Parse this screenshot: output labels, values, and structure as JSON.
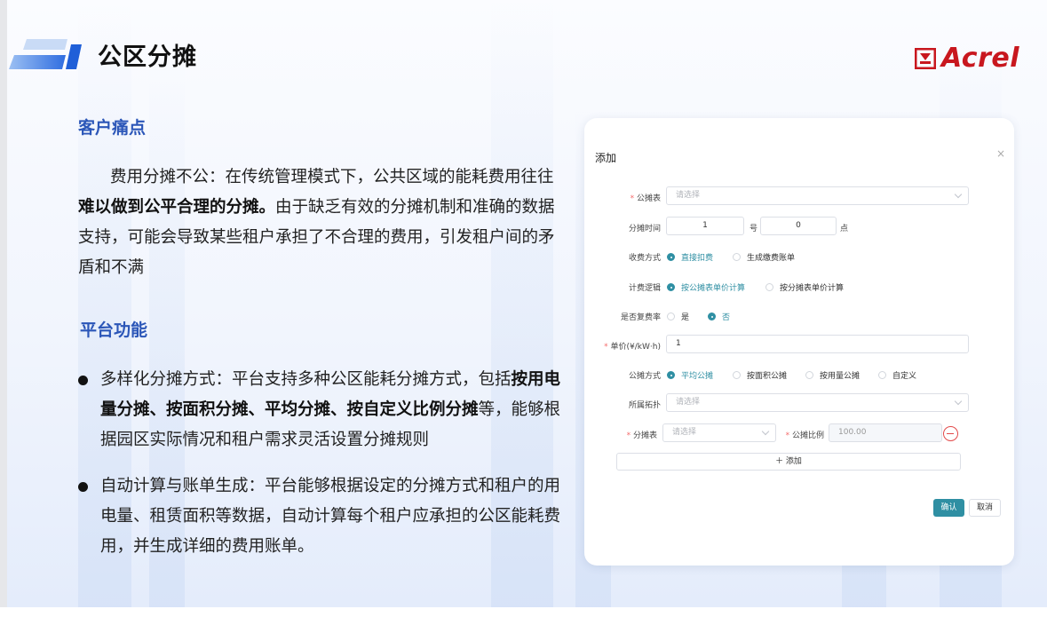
{
  "header": {
    "title": "公区分摊",
    "logo_text": "Acrel",
    "logo_color": "#c8171e"
  },
  "pain_points": {
    "heading": "客户痛点",
    "text_1": "费用分摊不公：在传统管理模式下，公共区域的能耗费用往往",
    "bold_1": "难以做到公平合理的分摊。",
    "text_2": "由于缺乏有效的分摊机制和准确的数据支持，可能会导致某些租户承担了不合理的费用，引发租户间的矛盾和不满"
  },
  "features": {
    "heading": "平台功能",
    "items": [
      {
        "text_1": "多样化分摊方式：平台支持多种公区能耗分摊方式，包括",
        "bold": "按用电量分摊、按面积分摊、平均分摊、按自定义比例分摊",
        "text_2": "等，能够根据园区实际情况和租户需求灵活设置分摊规则"
      },
      {
        "text_1": "自动计算与账单生成：平台能够根据设定的分摊方式和租户的用电量、租赁面积等数据，自动计算每个租户应承担的公区能耗费用，并生成详细的费用账单。",
        "bold": "",
        "text_2": ""
      }
    ]
  },
  "dialog": {
    "title": "添加",
    "close": "×",
    "meter_label": "公摊表",
    "meter_placeholder": "请选择",
    "time_label": "分摊时间",
    "day_value": "1",
    "day_unit": "号",
    "hour_value": "0",
    "hour_unit": "点",
    "charge_label": "收费方式",
    "charge_options": [
      "直接扣费",
      "生成缴费账单"
    ],
    "charge_selected": 0,
    "logic_label": "计费逻辑",
    "logic_options": [
      "按公摊表单价计算",
      "按分摊表单价计算"
    ],
    "logic_selected": 0,
    "multi_rate_label": "是否复费率",
    "multi_rate_options": [
      "是",
      "否"
    ],
    "multi_rate_selected": 1,
    "price_label": "单价(¥/kW·h)",
    "price_value": "1",
    "method_label": "公摊方式",
    "method_options": [
      "平均公摊",
      "按面积公摊",
      "按用量公摊",
      "自定义"
    ],
    "method_selected": 0,
    "topo_label": "所属拓扑",
    "topo_placeholder": "请选择",
    "share_meter_label": "分摊表",
    "share_meter_placeholder": "请选择",
    "ratio_label": "公摊比例",
    "ratio_value": "100.00",
    "add_label": "＋ 添加",
    "confirm_label": "确认",
    "cancel_label": "取消",
    "accent_color": "#2f8fa3",
    "required_mark": "*"
  }
}
